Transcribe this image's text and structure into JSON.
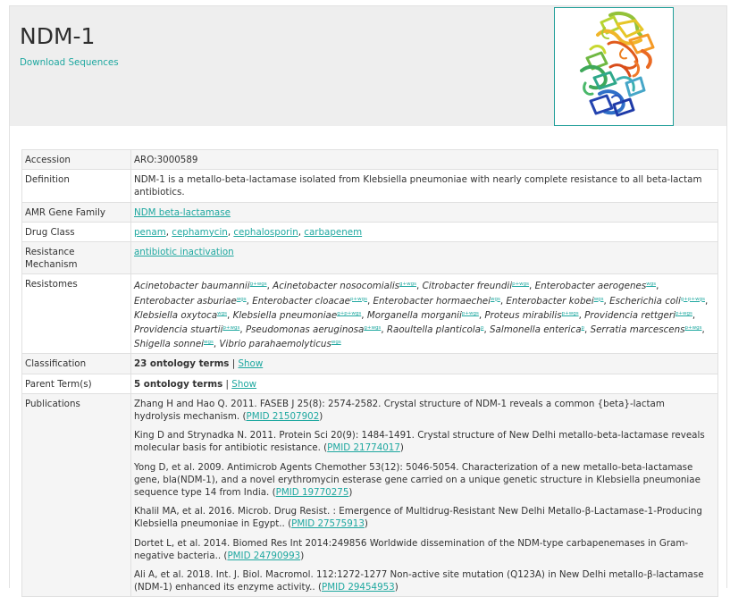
{
  "header": {
    "title": "NDM-1",
    "download_label": "Download Sequences"
  },
  "colors": {
    "accent": "#1fa8a0",
    "header_bg": "#eeeeee"
  },
  "rows": {
    "accession": {
      "label": "Accession",
      "value": "ARO:3000589"
    },
    "definition": {
      "label": "Definition",
      "value": "NDM-1 is a metallo-beta-lactamase isolated from Klebsiella pneumoniae with nearly complete resistance to all beta-lactam antibiotics."
    },
    "amr_gene_family": {
      "label": "AMR Gene Family",
      "value": "NDM beta-lactamase"
    },
    "drug_class": {
      "label": "Drug Class",
      "items": [
        "penam",
        "cephamycin",
        "cephalosporin",
        "carbapenem"
      ],
      "separator": ", "
    },
    "resistance_mechanism": {
      "label": "Resistance Mechanism",
      "value": "antibiotic inactivation"
    },
    "resistomes": {
      "label": "Resistomes",
      "items": [
        {
          "name": "Acinetobacter baumannii",
          "tag": "g+wgs"
        },
        {
          "name": "Acinetobacter nosocomialis",
          "tag": "g+wgs"
        },
        {
          "name": "Citrobacter freundii",
          "tag": "p+wgs"
        },
        {
          "name": "Enterobacter aerogenes",
          "tag": "wgs"
        },
        {
          "name": "Enterobacter asburiae",
          "tag": "wgs"
        },
        {
          "name": "Enterobacter cloacae",
          "tag": "p+wgs"
        },
        {
          "name": "Enterobacter hormaechei",
          "tag": "wgs"
        },
        {
          "name": "Enterobacter kobei",
          "tag": "wgs"
        },
        {
          "name": "Escherichia coli",
          "tag": "g+p+wgs"
        },
        {
          "name": "Klebsiella oxytoca",
          "tag": "wgs"
        },
        {
          "name": "Klebsiella pneumoniae",
          "tag": "g+p+wgs"
        },
        {
          "name": "Morganella morganii",
          "tag": "p+wgs"
        },
        {
          "name": "Proteus mirabilis",
          "tag": "p+wgs"
        },
        {
          "name": "Providencia rettgeri",
          "tag": "p+wgs"
        },
        {
          "name": "Providencia stuartii",
          "tag": "p+wgs"
        },
        {
          "name": "Pseudomonas aeruginosa",
          "tag": "g+wgs"
        },
        {
          "name": "Raoultella planticola",
          "tag": "p"
        },
        {
          "name": "Salmonella enterica",
          "tag": "p"
        },
        {
          "name": "Serratia marcescens",
          "tag": "p+wgs"
        },
        {
          "name": "Shigella sonnei",
          "tag": "wgs"
        },
        {
          "name": "Vibrio parahaemolyticus",
          "tag": "wgs"
        }
      ]
    },
    "classification": {
      "label": "Classification",
      "count_text": "23 ontology terms",
      "separator": " | ",
      "show_label": "Show"
    },
    "parent_terms": {
      "label": "Parent Term(s)",
      "count_text": "5 ontology terms",
      "separator": " | ",
      "show_label": "Show"
    },
    "publications": {
      "label": "Publications",
      "items": [
        {
          "text": "Zhang H and Hao Q. 2011. FASEB J 25(8): 2574-2582. Crystal structure of NDM-1 reveals a common {beta}-lactam hydrolysis mechanism. (",
          "pmid": "PMID 21507902",
          "close": ")"
        },
        {
          "text": "King D and Strynadka N. 2011. Protein Sci 20(9): 1484-1491. Crystal structure of New Delhi metallo-beta-lactamase reveals molecular basis for antibiotic resistance. (",
          "pmid": "PMID 21774017",
          "close": ")"
        },
        {
          "text": "Yong D, et al. 2009. Antimicrob Agents Chemother 53(12): 5046-5054. Characterization of a new metallo-beta-lactamase gene, bla(NDM-1), and a novel erythromycin esterase gene carried on a unique genetic structure in Klebsiella pneumoniae sequence type 14 from India. (",
          "pmid": "PMID 19770275",
          "close": ")"
        },
        {
          "text": "Khalil MA, et al. 2016. Microb. Drug Resist. : Emergence of Multidrug-Resistant New Delhi Metallo-β-Lactamase-1-Producing Klebsiella pneumoniae in Egypt.. (",
          "pmid": "PMID 27575913",
          "close": ")"
        },
        {
          "text": "Dortet L, et al. 2014. Biomed Res Int 2014:249856 Worldwide dissemination of the NDM-type carbapenemases in Gram-negative bacteria.. (",
          "pmid": "PMID 24790993",
          "close": ")"
        },
        {
          "text": "Ali A, et al. 2018. Int. J. Biol. Macromol. 112:1272-1277 Non-active site mutation (Q123A) in New Delhi metallo-β-lactamase (NDM-1) enhanced its enzyme activity.. (",
          "pmid": "PMID 29454953",
          "close": ")"
        }
      ]
    }
  }
}
